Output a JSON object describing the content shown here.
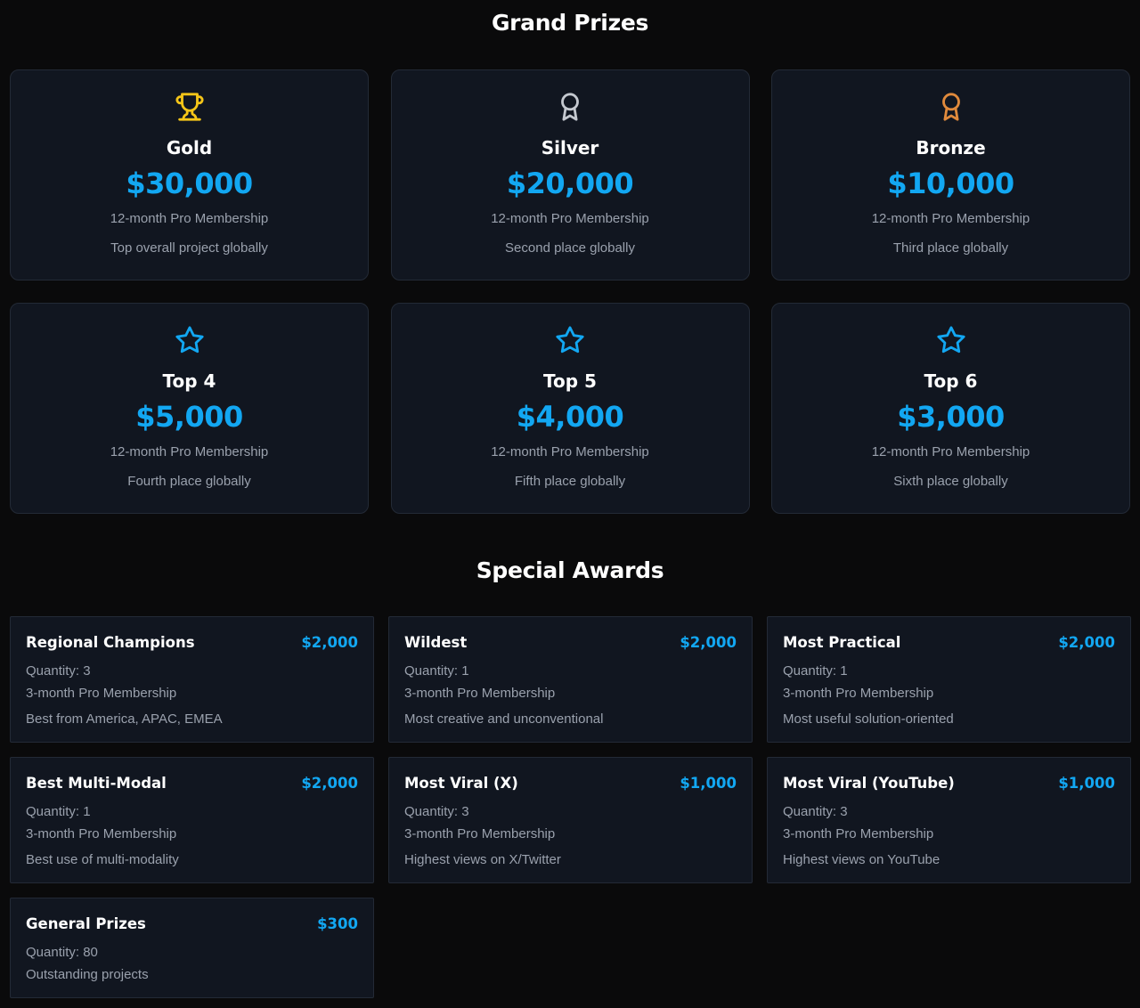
{
  "grand_prizes": {
    "title": "Grand Prizes",
    "cards": [
      {
        "icon": "trophy-icon",
        "icon_color": "#f5c518",
        "name": "Gold",
        "amount": "$30,000",
        "membership": "12-month Pro Membership",
        "description": "Top overall project globally"
      },
      {
        "icon": "medal-icon",
        "icon_color": "#c4c8cf",
        "name": "Silver",
        "amount": "$20,000",
        "membership": "12-month Pro Membership",
        "description": "Second place globally"
      },
      {
        "icon": "medal-icon",
        "icon_color": "#e08a3c",
        "name": "Bronze",
        "amount": "$10,000",
        "membership": "12-month Pro Membership",
        "description": "Third place globally"
      },
      {
        "icon": "star-icon",
        "icon_color": "#12a7f2",
        "name": "Top 4",
        "amount": "$5,000",
        "membership": "12-month Pro Membership",
        "description": "Fourth place globally"
      },
      {
        "icon": "star-icon",
        "icon_color": "#12a7f2",
        "name": "Top 5",
        "amount": "$4,000",
        "membership": "12-month Pro Membership",
        "description": "Fifth place globally"
      },
      {
        "icon": "star-icon",
        "icon_color": "#12a7f2",
        "name": "Top 6",
        "amount": "$3,000",
        "membership": "12-month Pro Membership",
        "description": "Sixth place globally"
      }
    ]
  },
  "special_awards": {
    "title": "Special Awards",
    "cards": [
      {
        "name": "Regional Champions",
        "amount": "$2,000",
        "quantity": "Quantity: 3",
        "membership": "3-month Pro Membership",
        "description": "Best from America, APAC, EMEA"
      },
      {
        "name": "Wildest",
        "amount": "$2,000",
        "quantity": "Quantity: 1",
        "membership": "3-month Pro Membership",
        "description": "Most creative and unconventional"
      },
      {
        "name": "Most Practical",
        "amount": "$2,000",
        "quantity": "Quantity: 1",
        "membership": "3-month Pro Membership",
        "description": "Most useful solution-oriented"
      },
      {
        "name": "Best Multi-Modal",
        "amount": "$2,000",
        "quantity": "Quantity: 1",
        "membership": "3-month Pro Membership",
        "description": "Best use of multi-modality"
      },
      {
        "name": "Most Viral (X)",
        "amount": "$1,000",
        "quantity": "Quantity: 3",
        "membership": "3-month Pro Membership",
        "description": "Highest views on X/Twitter"
      },
      {
        "name": "Most Viral (YouTube)",
        "amount": "$1,000",
        "quantity": "Quantity: 3",
        "membership": "3-month Pro Membership",
        "description": "Highest views on YouTube"
      },
      {
        "name": "General Prizes",
        "amount": "$300",
        "quantity": "Quantity: 80",
        "membership": "",
        "description": "Outstanding projects"
      }
    ]
  },
  "colors": {
    "accent": "#12a7f2",
    "background": "#0a0a0b",
    "card": "#111620",
    "muted_text": "#9aa1ad"
  }
}
